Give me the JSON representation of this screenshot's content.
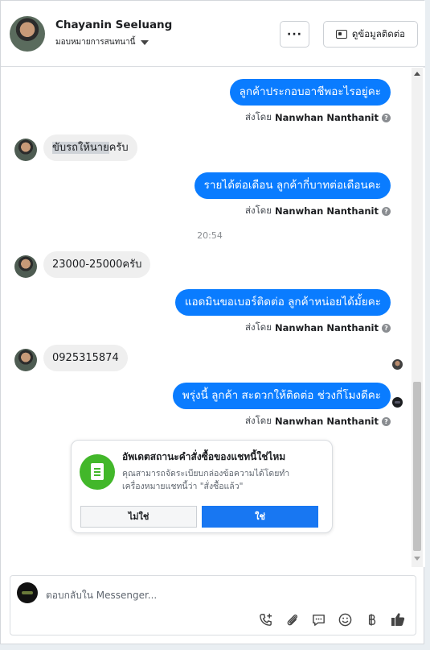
{
  "header": {
    "name": "Chayanin Seeluang",
    "assign_label": "มอบหมายการสนทนานี้",
    "more_label": "···",
    "contact_label": "ดูข้อมูลติดต่อ"
  },
  "messages": {
    "m1": "ลูกค้าประกอบอาชีพอะไรอยู่คะ",
    "m2_highlight": "ขับรถให้นาย",
    "m2_rest": "ครับ",
    "m3": "รายได้ต่อเดือน ลูกค้ากี่บาทต่อเดือนคะ",
    "time": "20:54",
    "m4": "23000-25000ครับ",
    "m5": "แอดมินขอเบอร์ติดต่อ ลูกค้าหน่อยได้มั้ยคะ",
    "m6": "0925315874",
    "m7": "พรุ่งนี้ ลูกค้า สะดวกให้ติดต่อ ช่วงกี่โมงดีคะ"
  },
  "sent_by": {
    "prefix": "ส่งโดย",
    "agent": "Nanwhan Nanthanit",
    "help": "?"
  },
  "card": {
    "title": "อัพเดตสถานะคำสั่งซื้อของแชทนี้ใช่ไหม",
    "description": "คุณสามารถจัดระเบียบกล่องข้อความได้โดยทำเครื่องหมายแชทนี้ว่า \"สั่งซื้อแล้ว\"",
    "no_label": "ไม่ใช่",
    "yes_label": "ใช่"
  },
  "composer": {
    "placeholder": "ตอบกลับใน Messenger..."
  },
  "icons": [
    "more-icon",
    "contact-card-icon",
    "chevron-down-icon",
    "help-icon",
    "order-document-icon",
    "call-add-icon",
    "attachment-icon",
    "saved-reply-icon",
    "emoji-icon",
    "baht-icon",
    "like-icon"
  ],
  "colors": {
    "outgoing_bubble": "#0a7cff",
    "incoming_bubble": "#efefef",
    "primary_button": "#1877f2",
    "card_icon": "#42b72a"
  }
}
